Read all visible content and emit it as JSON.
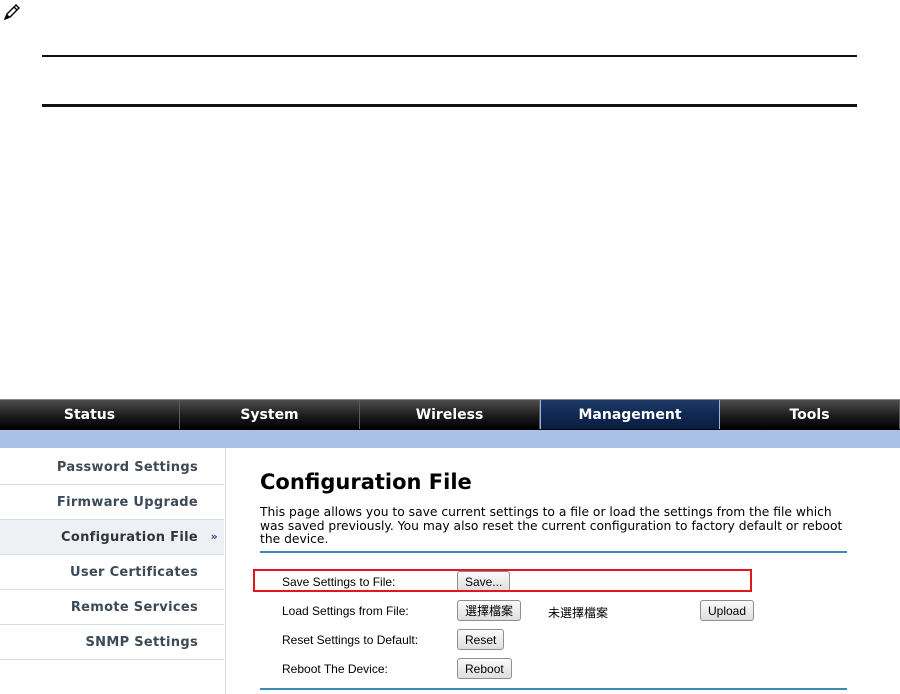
{
  "navbar": {
    "tabs": [
      {
        "label": "Status"
      },
      {
        "label": "System"
      },
      {
        "label": "Wireless"
      },
      {
        "label": "Management"
      },
      {
        "label": "Tools"
      }
    ],
    "active_tab": "Management"
  },
  "sidebar": {
    "items": [
      {
        "label": "Password Settings"
      },
      {
        "label": "Firmware Upgrade"
      },
      {
        "label": "Configuration File"
      },
      {
        "label": "User Certificates"
      },
      {
        "label": "Remote Services"
      },
      {
        "label": "SNMP Settings"
      }
    ],
    "active_item": "Configuration File",
    "active_marker": "»"
  },
  "main": {
    "title": "Configuration File",
    "description": "This page allows you to save current settings to a file or load the settings from the file which was saved previously. You may also reset the current configuration to factory default or reboot the device.",
    "rows": {
      "save": {
        "label": "Save Settings to File:",
        "button": "Save..."
      },
      "load": {
        "label": "Load Settings from File:",
        "choose_button": "選擇檔案",
        "file_status": "未選擇檔案",
        "upload_button": "Upload"
      },
      "reset": {
        "label": "Reset Settings to Default:",
        "button": "Reset"
      },
      "reboot": {
        "label": "Reboot The Device:",
        "button": "Reboot"
      }
    }
  },
  "colors": {
    "highlight": "#e3161d",
    "nav_active": "#0e2650",
    "subbar": "#a9c1e6",
    "divider": "#3b8ab4"
  },
  "icons": {
    "note": "pencil-icon"
  }
}
